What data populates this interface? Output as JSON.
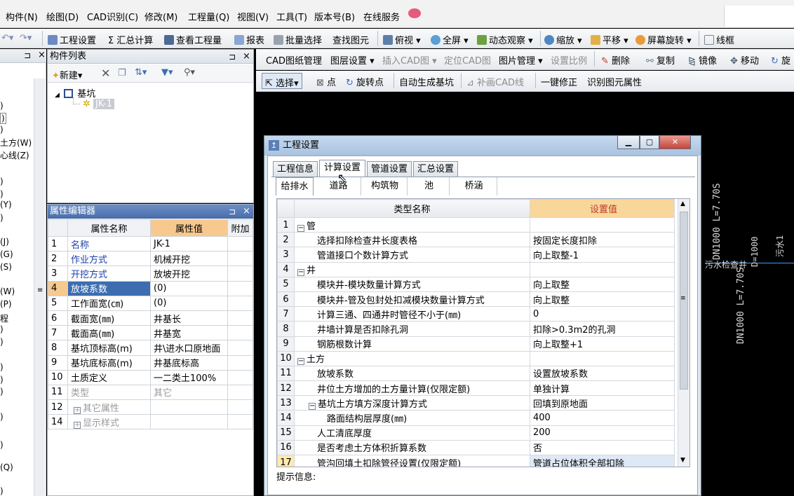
{
  "menubar": {
    "items": [
      "构件(N)",
      "绘图(D)",
      "CAD识别(C)",
      "修改(M)",
      "工程量(Q)",
      "视图(V)",
      "工具(T)",
      "版本号(B)",
      "在线服务"
    ]
  },
  "toolbar1": {
    "project_settings": "工程设置",
    "summary_calc": "汇总计算",
    "view_quantity": "查看工程量",
    "report": "报表",
    "batch_select": "批量选择",
    "find_element": "查找图元",
    "top_view": "俯视",
    "full_screen": "全屏",
    "dynamic_view": "动态观察",
    "zoom": "缩放",
    "pan": "平移",
    "screen_rotate": "屏幕旋转",
    "wireframe": "线框"
  },
  "left_strip": {
    "items": [
      ")",
      ")",
      ")",
      "土方(W)",
      "心线(Z)",
      ")",
      ")",
      "(Y)",
      ")",
      "(J)",
      "(G)",
      "(S)",
      "(W)",
      "(P)",
      "程",
      ")",
      ")",
      ")",
      ")",
      ")",
      ")",
      ")",
      "(Q)",
      ")"
    ]
  },
  "component_list": {
    "title": "构件列表",
    "new_button": "新建",
    "tree_root": "基坑",
    "tree_child": "JK-1"
  },
  "property_editor": {
    "title": "属性编辑器",
    "headers": [
      "属性名称",
      "属性值",
      "附加"
    ],
    "rows": [
      {
        "n": "1",
        "name": "名称",
        "value": "JK-1"
      },
      {
        "n": "2",
        "name": "作业方式",
        "value": "机械开挖"
      },
      {
        "n": "3",
        "name": "开挖方式",
        "value": "放坡开挖"
      },
      {
        "n": "4",
        "name": "放坡系数",
        "value": "(0)"
      },
      {
        "n": "5",
        "name": "工作面宽(㎝)",
        "value": "(0)"
      },
      {
        "n": "6",
        "name": "截面宽(㎜)",
        "value": "井基长"
      },
      {
        "n": "7",
        "name": "截面高(㎜)",
        "value": "井基宽"
      },
      {
        "n": "8",
        "name": "基坑顶标高(m)",
        "value": "井\\进水口原地面"
      },
      {
        "n": "9",
        "name": "基坑底标高(m)",
        "value": "井基底标高"
      },
      {
        "n": "10",
        "name": "土质定义",
        "value": "一二类土100%"
      },
      {
        "n": "11",
        "name": "类型",
        "value": "其它"
      },
      {
        "n": "12",
        "name": "其它属性",
        "value": ""
      },
      {
        "n": "14",
        "name": "显示样式",
        "value": ""
      }
    ]
  },
  "cad_toolbar1": {
    "drawing_mgmt": "CAD图纸管理",
    "layer_settings": "图层设置",
    "insert_cad": "插入CAD图",
    "locate_cad": "定位CAD图",
    "image_mgmt": "图片管理",
    "set_scale": "设置比例",
    "delete": "删除",
    "copy": "复制",
    "mirror": "镜像",
    "move": "移动",
    "rotate": "旋"
  },
  "cad_toolbar2": {
    "select": "选择",
    "point": "点",
    "rotate_point": "旋转点",
    "auto_gen_pit": "自动生成基坑",
    "draw_cad_line": "补画CAD线",
    "one_click_fix": "一键修正",
    "identify_attr": "识别图元属性"
  },
  "cad_texts": {
    "t1": "DN1000 L=7.70S",
    "t2": "DN1000 L=7.70S",
    "t3": "污水检查井",
    "t4": "D=1000",
    "t5": "污水1"
  },
  "dialog": {
    "title": "工程设置",
    "tabs": [
      "工程信息",
      "计算设置",
      "管道设置",
      "汇总设置"
    ],
    "subtabs": [
      "给排水",
      "道路",
      "构筑物",
      "池",
      "桥涵"
    ],
    "col_name": "类型名称",
    "col_value": "设置值",
    "hint": "提示信息:",
    "rows": [
      {
        "n": "1",
        "level": 0,
        "toggle": "−",
        "name": "管",
        "value": ""
      },
      {
        "n": "2",
        "level": 1,
        "toggle": "",
        "name": "选择扣除检查井长度表格",
        "value": "按固定长度扣除"
      },
      {
        "n": "3",
        "level": 1,
        "toggle": "",
        "name": "管道接口个数计算方式",
        "value": "向上取整-1"
      },
      {
        "n": "4",
        "level": 0,
        "toggle": "−",
        "name": "井",
        "value": ""
      },
      {
        "n": "5",
        "level": 1,
        "toggle": "",
        "name": "模块井-模块数量计算方式",
        "value": "向上取整"
      },
      {
        "n": "6",
        "level": 1,
        "toggle": "",
        "name": "模块井-管及包封处扣减模块数量计算方式",
        "value": "向上取整"
      },
      {
        "n": "7",
        "level": 1,
        "toggle": "",
        "name": "计算三通、四通井时管径不小于(㎜)",
        "value": "0"
      },
      {
        "n": "8",
        "level": 1,
        "toggle": "",
        "name": "井墙计算是否扣除孔洞",
        "value": "扣除>0.3m2的孔洞"
      },
      {
        "n": "9",
        "level": 1,
        "toggle": "",
        "name": "钢筋根数计算",
        "value": "向上取整+1"
      },
      {
        "n": "10",
        "level": 0,
        "toggle": "−",
        "name": "土方",
        "value": ""
      },
      {
        "n": "11",
        "level": 1,
        "toggle": "",
        "name": "放坡系数",
        "value": "设置放坡系数"
      },
      {
        "n": "12",
        "level": 1,
        "toggle": "",
        "name": "井位土方增加的土方量计算(仅限定额)",
        "value": "单独计算"
      },
      {
        "n": "13",
        "level": 1,
        "toggle": "−",
        "name": "基坑土方填方深度计算方式",
        "value": "回填到原地面"
      },
      {
        "n": "14",
        "level": 2,
        "toggle": "",
        "name": "路面结构层厚度(㎜)",
        "value": "400"
      },
      {
        "n": "15",
        "level": 1,
        "toggle": "",
        "name": "人工清底厚度",
        "value": "200"
      },
      {
        "n": "16",
        "level": 1,
        "toggle": "",
        "name": "是否考虑土方体积折算系数",
        "value": "否"
      },
      {
        "n": "17",
        "level": 1,
        "toggle": "",
        "name": "管沟回填土扣除管径设置(仅限定额)",
        "value": "管道占位体积全部扣除"
      }
    ]
  }
}
